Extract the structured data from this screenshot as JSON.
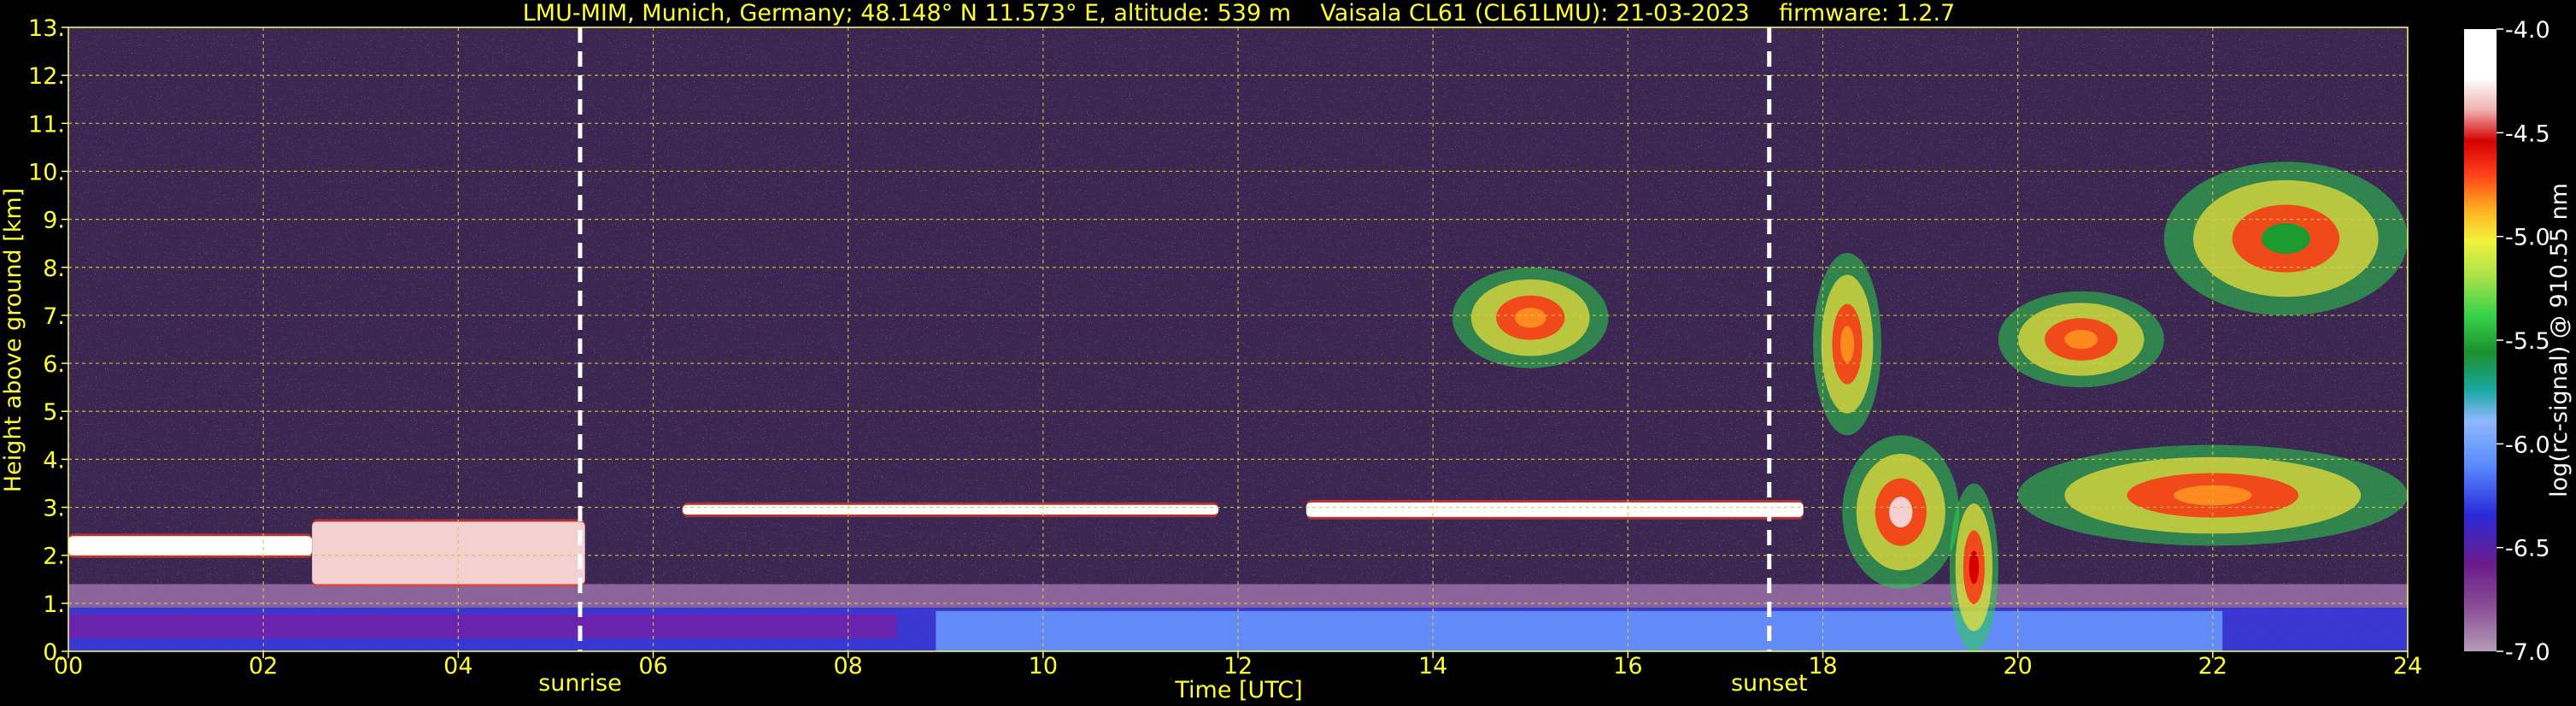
{
  "chart_data": {
    "type": "heatmap",
    "title": "LMU-MIM, Munich, Germany; 48.148° N 11.573° E, altitude: 539 m    Vaisala CL61 (CL61LMU): 21-03-2023    firmware: 1.2.7",
    "xlabel": "Time [UTC]",
    "ylabel": "Height above ground [km]",
    "xlim": [
      0,
      24
    ],
    "ylim": [
      0,
      13
    ],
    "xticks": [
      0,
      2,
      4,
      6,
      8,
      10,
      12,
      14,
      16,
      18,
      20,
      22,
      24
    ],
    "xtick_labels": [
      "00",
      "02",
      "04",
      "06",
      "08",
      "10",
      "12",
      "14",
      "16",
      "18",
      "20",
      "22",
      "24"
    ],
    "yticks": [
      0,
      1,
      2,
      3,
      4,
      5,
      6,
      7,
      8,
      9,
      10,
      11,
      12,
      13
    ],
    "ytick_labels": [
      "0.",
      "1.",
      "2.",
      "3.",
      "4.",
      "5.",
      "6.",
      "7.",
      "8.",
      "9.",
      "10.",
      "11.",
      "12.",
      "13."
    ],
    "grid": true,
    "events": [
      {
        "label": "sunrise",
        "x": 5.25
      },
      {
        "label": "sunset",
        "x": 17.45
      }
    ],
    "colorbar": {
      "label": "log(rc-signal) @ 910.55 nm",
      "min": -7.0,
      "max": -4.0,
      "ticks": [
        -4.0,
        -4.5,
        -5.0,
        -5.5,
        -6.0,
        -6.5,
        -7.0
      ],
      "tick_labels": [
        "-4.0",
        "-4.5",
        "-5.0",
        "-5.5",
        "-6.0",
        "-6.5",
        "-7.0"
      ]
    },
    "features": [
      {
        "kind": "boundary-layer",
        "x": [
          0,
          24
        ],
        "y": [
          0,
          1.4
        ],
        "level": -6.1
      },
      {
        "kind": "cloud-layer",
        "x": [
          0,
          2.5
        ],
        "y": [
          2.0,
          2.4
        ],
        "level": -4.0
      },
      {
        "kind": "cloud-layer",
        "x": [
          2.5,
          5.3
        ],
        "y": [
          1.4,
          2.7
        ],
        "level": -4.3
      },
      {
        "kind": "cloud-layer",
        "x": [
          6.3,
          11.8
        ],
        "y": [
          2.85,
          3.05
        ],
        "level": -4.0
      },
      {
        "kind": "cloud-layer",
        "x": [
          12.7,
          17.8
        ],
        "y": [
          2.8,
          3.1
        ],
        "level": -4.0
      },
      {
        "kind": "cloud",
        "x": [
          14.2,
          15.8
        ],
        "y": [
          5.9,
          8.0
        ],
        "level": -5.0
      },
      {
        "kind": "cloud",
        "x": [
          17.9,
          18.6
        ],
        "y": [
          4.5,
          8.3
        ],
        "level": -5.1
      },
      {
        "kind": "cloud",
        "x": [
          18.2,
          19.4
        ],
        "y": [
          1.3,
          4.5
        ],
        "level": -4.3
      },
      {
        "kind": "cloud",
        "x": [
          19.3,
          19.8
        ],
        "y": [
          0.0,
          3.5
        ],
        "level": -4.6
      },
      {
        "kind": "cloud",
        "x": [
          19.8,
          21.5
        ],
        "y": [
          5.5,
          7.5
        ],
        "level": -5.0
      },
      {
        "kind": "cloud",
        "x": [
          20.0,
          24.0
        ],
        "y": [
          2.2,
          4.3
        ],
        "level": -5.0
      },
      {
        "kind": "cloud",
        "x": [
          21.5,
          24.0
        ],
        "y": [
          7.0,
          10.2
        ],
        "level": -5.6
      }
    ]
  }
}
